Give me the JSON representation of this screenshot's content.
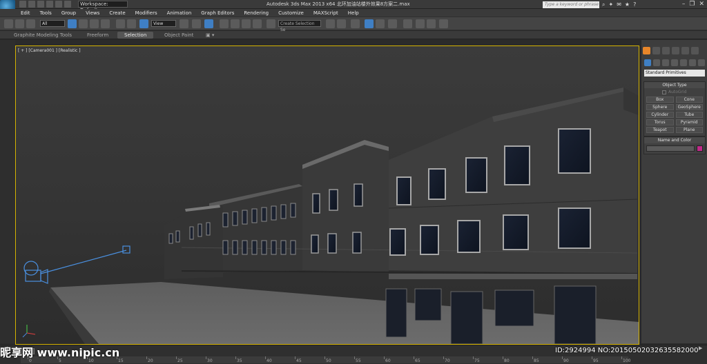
{
  "window": {
    "title": "Autodesk 3ds Max  2013 x64      北环加油站楼外效果8方案二.max",
    "workspace": "Workspace: Default",
    "search_placeholder": "Type a keyword or phrase"
  },
  "menu": [
    "Edit",
    "Tools",
    "Group",
    "Views",
    "Create",
    "Modifiers",
    "Animation",
    "Graph Editors",
    "Rendering",
    "Customize",
    "MAXScript",
    "Help"
  ],
  "toolbar": {
    "selection_filter": "All",
    "reference_coord": "View",
    "named_selection": "Create Selection Se"
  },
  "ribbon": {
    "tabs": [
      "Graphite Modeling Tools",
      "Freeform",
      "Selection",
      "Object Paint"
    ],
    "active_tab": "Selection"
  },
  "viewport": {
    "label": "[ + ] [Camera001 ] [Realistic ]"
  },
  "command_panel": {
    "category": "Standard Primitives",
    "object_type_title": "Object Type",
    "autogrid_label": "AutoGrid",
    "primitives": [
      "Box",
      "Cone",
      "Sphere",
      "GeoSphere",
      "Cylinder",
      "Tube",
      "Torus",
      "Pyramid",
      "Teapot",
      "Plane"
    ],
    "name_color_title": "Name and Color",
    "object_color": "#c02a8a"
  },
  "timeline": {
    "ticks": [
      "0",
      "5",
      "10",
      "15",
      "20",
      "25",
      "30",
      "35",
      "40",
      "45",
      "50",
      "55",
      "60",
      "65",
      "70",
      "75",
      "80",
      "85",
      "90",
      "95",
      "100"
    ]
  },
  "watermark": {
    "site": "昵享网 www.nipic.cn",
    "id": "ID:2924994 NO:20150502032635582000"
  },
  "colors": {
    "viewport_border": "#d6b400",
    "active_tab": "#e8862a",
    "accent_blue": "#3f7fc4"
  }
}
